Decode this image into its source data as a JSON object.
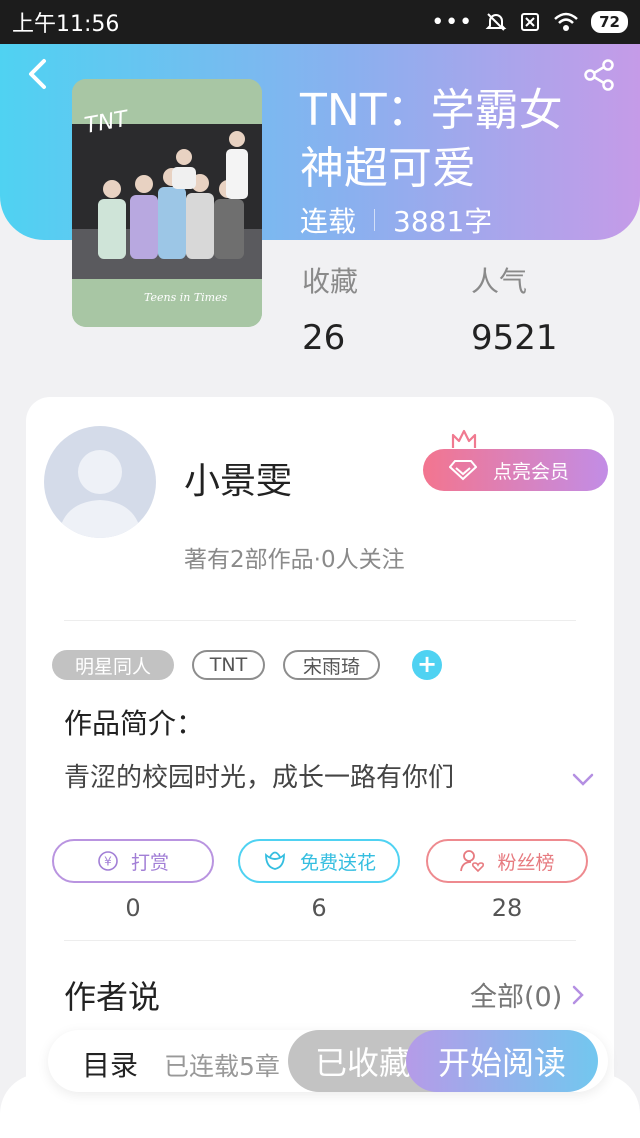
{
  "status_bar": {
    "time": "上午11:56",
    "battery": "72"
  },
  "book": {
    "title_line1": "TNT：学霸女",
    "title_line2": "神超可爱",
    "status": "连载",
    "word_count": "3881字",
    "cover_text": "TNT",
    "cover_caption": "Teens in Times",
    "favorites_label": "收藏",
    "favorites_value": "26",
    "popularity_label": "人气",
    "popularity_value": "9521"
  },
  "author": {
    "name": "小景雯",
    "vip_label": "点亮会员",
    "works_info": "著有2部作品·0人关注"
  },
  "tags": [
    "明星同人",
    "TNT",
    "宋雨琦"
  ],
  "intro": {
    "heading": "作品简介：",
    "text": "青涩的校园时光，成长一路有你们"
  },
  "actions": [
    {
      "label": "打赏",
      "count": "0"
    },
    {
      "label": "免费送花",
      "count": "6"
    },
    {
      "label": "粉丝榜",
      "count": "28"
    }
  ],
  "author_says": {
    "heading": "作者说",
    "all_label": "全部(0)"
  },
  "bottom_bar": {
    "toc_label": "目录",
    "serial_info": "已连载5章",
    "saved_label": "已收藏",
    "read_label": "开始阅读"
  },
  "colors": {
    "accent_cyan": "#4fd2f2",
    "accent_purple": "#c59be8",
    "vip_pink": "#f3758f"
  }
}
